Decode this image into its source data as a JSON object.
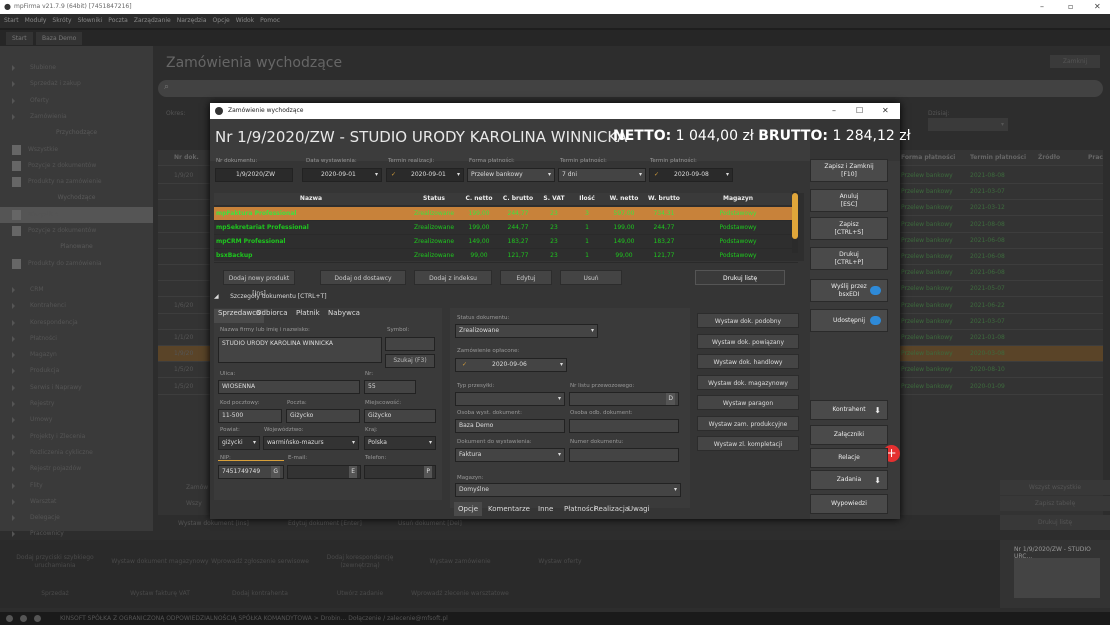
{
  "os_title": "mpFirma v21.7.9 (64bit) [7451847216]",
  "menu": [
    "Start",
    "Moduły",
    "Skróty",
    "Słowniki",
    "Poczta",
    "Zarządzanie",
    "Narzędzia",
    "Opcje",
    "Widok",
    "Pomoc"
  ],
  "app_tabs": [
    "Start",
    "Baza Demo"
  ],
  "sidebar": {
    "items": [
      {
        "label": "Słubione",
        "type": "item"
      },
      {
        "label": "Sprzedaż i zakup",
        "type": "item"
      },
      {
        "label": "Oferty",
        "type": "item"
      },
      {
        "label": "Zamówienia",
        "type": "item"
      },
      {
        "label": "Przychodzące",
        "type": "header"
      },
      {
        "label": "Wszystkie",
        "type": "sub"
      },
      {
        "label": "Pozycje z dokumentów",
        "type": "sub"
      },
      {
        "label": "Produkty na zamówienie",
        "type": "sub"
      },
      {
        "label": "Wychodzące",
        "type": "header"
      },
      {
        "label": "Wszystkie",
        "type": "sub"
      },
      {
        "label": "Pozycje z dokumentów",
        "type": "sub"
      },
      {
        "label": "Planowane",
        "type": "header"
      },
      {
        "label": "Produkty do zamówienia",
        "type": "sub"
      },
      {
        "label": "",
        "type": "gap"
      },
      {
        "label": "CRM",
        "type": "item"
      },
      {
        "label": "Kontrahenci",
        "type": "item"
      },
      {
        "label": "Korespondencja",
        "type": "item"
      },
      {
        "label": "Płatności",
        "type": "item"
      },
      {
        "label": "Magazyn",
        "type": "item"
      },
      {
        "label": "Produkcja",
        "type": "item"
      },
      {
        "label": "Serwis i Naprawy",
        "type": "item"
      },
      {
        "label": "Rejestry",
        "type": "item"
      },
      {
        "label": "Umowy",
        "type": "item"
      },
      {
        "label": "Projekty i Zlecenia",
        "type": "item"
      },
      {
        "label": "Rozliczenia cykliczne",
        "type": "item"
      },
      {
        "label": "Rejestr pojazdów",
        "type": "item"
      },
      {
        "label": "Flity",
        "type": "item"
      },
      {
        "label": "Warsztat",
        "type": "item"
      },
      {
        "label": "Delegacje",
        "type": "item"
      },
      {
        "label": "Pracownicy",
        "type": "item"
      }
    ]
  },
  "page": {
    "title": "Zamówienia wychodzące",
    "close": "Zamknij"
  },
  "bg_filters": {
    "left": "Okres:",
    "right": "Dzisiaj:"
  },
  "bg_table": {
    "headers": [
      "Nr dok.",
      "Forma płatności",
      "Termin płatności",
      "Źródło",
      "Prac"
    ],
    "rows": [
      {
        "nr": "",
        "forma": "Przelew bankowy",
        "termin": "2021-08-08"
      },
      {
        "nr": "",
        "forma": "Przelew bankowy",
        "termin": "2021-03-07"
      },
      {
        "nr": "",
        "forma": "Przelew bankowy",
        "termin": "2021-03-12"
      },
      {
        "nr": "",
        "forma": "Przelew bankowy",
        "termin": "2021-08-08"
      },
      {
        "nr": "",
        "forma": "Przelew bankowy",
        "termin": "2021-06-08"
      },
      {
        "nr": "",
        "forma": "Przelew bankowy",
        "termin": "2021-06-08"
      },
      {
        "nr": "",
        "forma": "Przelew bankowy",
        "termin": "2021-06-08"
      },
      {
        "nr": "",
        "forma": "Przelew bankowy",
        "termin": "2021-05-07"
      },
      {
        "nr": "",
        "forma": "Przelew bankowy",
        "termin": "2021-06-22"
      },
      {
        "nr": "",
        "forma": "Przelew bankowy",
        "termin": "2021-03-07"
      },
      {
        "nr": "",
        "forma": "Przelew bankowy",
        "termin": "2021-01-08"
      },
      {
        "nr": "",
        "forma": "Przelew bankowy",
        "termin": "2020-03-08"
      },
      {
        "nr": "",
        "forma": "Przelew bankowy",
        "termin": "2020-08-10"
      },
      {
        "nr": "",
        "forma": "Przelew bankowy",
        "termin": "2020-01-09"
      }
    ],
    "row_dates": [
      "1/9/20",
      "",
      "",
      "",
      "",
      "",
      "",
      "",
      "1/6/20",
      "",
      "1/1/20",
      "1/9/20",
      "1/5/20",
      "1/5/20"
    ],
    "bottom_buttons": [
      "Wystaw dokument [Ins]",
      "Edytuj dokument [Enter]",
      "Usuń dokument [Del]"
    ],
    "left_labels": [
      "Zamów",
      "Wszy"
    ]
  },
  "bg_right_buttons": [
    "Wszyst wszystkie",
    "Zapisz tabelę",
    "Drukuj listę"
  ],
  "bottom_tiles": [
    "Dodaj przyciski szybkiego uruchamiania",
    "Wystaw dokument magazynowy",
    "Wprowadź zgłoszenie serwisowe",
    "Dodaj korespondencję (zewnętrzną)",
    "Wystaw zamówienie",
    "Wystaw oferty",
    "Sprzedaż",
    "Wystaw fakturę VAT",
    "Dodaj kontrahenta",
    "Utwórz zadanie",
    "Wprowadź zlecenie warsztatowe"
  ],
  "thumb_title": "Nr 1/9/2020/ZW - STUDIO URC...",
  "status": "KINSOFT SPÓŁKA Z OGRANICZONĄ ODPOWIEDZIALNOŚCIĄ SPÓŁKA KOMANDYTOWA > Drobin... Dołączenie / zalecenie@mfsoft.pl",
  "dialog": {
    "title": "Zamówienie wychodzące",
    "doc_header": "Nr 1/9/2020/ZW - STUDIO URODY KAROLINA WINNICKA",
    "netto_label": "NETTO:",
    "netto_value": "1 044,00 zł",
    "brutto_label": "BRUTTO:",
    "brutto_value": "1 284,12 zł",
    "fields": {
      "nr_label": "Nr dokumentu:",
      "nr": "1/9/2020/ZW",
      "data_label": "Data wystawienia:",
      "data": "2020-09-01",
      "termin_real_label": "Termin realizacji:",
      "termin_real": "2020-09-01",
      "forma_label": "Forma płatności:",
      "forma": "Przelew bankowy",
      "termin_plat_label": "Termin płatności:",
      "termin_plat": "7 dni",
      "termin_plat2_label": "Termin płatności:",
      "termin_plat2": "2020-09-08"
    },
    "grid": {
      "headers": [
        "Nazwa",
        "Status",
        "C. netto",
        "C. brutto",
        "S. VAT",
        "Ilość",
        "W. netto",
        "W. brutto",
        "Magazyn"
      ],
      "rows": [
        [
          "mpFaktura Professional",
          "Zrealizowane",
          "199,00",
          "244,77",
          "23",
          "3",
          "597,00",
          "734,31",
          "Podstawowy"
        ],
        [
          "mpSekretariat Professional",
          "Zrealizowane",
          "199,00",
          "244,77",
          "23",
          "1",
          "199,00",
          "244,77",
          "Podstawowy"
        ],
        [
          "mpCRM Professional",
          "Zrealizowane",
          "149,00",
          "183,27",
          "23",
          "1",
          "149,00",
          "183,27",
          "Podstawowy"
        ],
        [
          "bsxBackup",
          "Zrealizowane",
          "99,00",
          "121,77",
          "23",
          "1",
          "99,00",
          "121,77",
          "Podstawowy"
        ]
      ]
    },
    "grid_buttons": [
      "Dodaj nowy produkt [Ins]",
      "Dodaj od dostawcy",
      "Dodaj z indeksu",
      "Edytuj",
      "Usuń",
      "Drukuj listę"
    ],
    "details_toggle": "Szczegóły dokumentu [CTRL+T]",
    "party_tabs": [
      "Sprzedawca",
      "Odbiorca",
      "Płatnik",
      "Nabywca"
    ],
    "party": {
      "name_label": "Nazwa firmy lub imię i nazwisko:",
      "name": "STUDIO URODY KAROLINA WINNICKA",
      "symbol_label": "Symbol:",
      "symbol": "",
      "search_btn": "Szukaj (F3)",
      "ulica_label": "Ulica:",
      "ulica": "WIOSENNA",
      "nr_label": "Nr:",
      "nr": "55",
      "kod_label": "Kod pocztowy:",
      "kod": "11-500",
      "poczta_label": "Poczta:",
      "poczta": "Giżycko",
      "miejsc_label": "Miejscowość:",
      "miejsc": "Giżycko",
      "powiat_label": "Powiat:",
      "powiat": "giżycki",
      "woj_label": "Województwo:",
      "woj": "warmińsko-mazurs",
      "kraj_label": "Kraj:",
      "kraj": "Polska",
      "nip_label": "NIP:",
      "nip": "7451749749",
      "nip_btn": "G",
      "email_label": "E-mail:",
      "email": "",
      "email_btn": "E",
      "tel_label": "Telefon:",
      "tel": "",
      "tel_btn": "P"
    },
    "options": {
      "status_label": "Status dokumentu:",
      "status": "Zrealizowane",
      "paid_label": "Zamówienie opłacone:",
      "paid_date": "2020-09-06",
      "przesylka_label": "Typ przesyłki:",
      "przesylka": "",
      "nr_listu_label": "Nr listu przewozowego:",
      "nr_listu": "",
      "nr_listu_btn": "D",
      "osoba_wyst_label": "Osoba wyst. dokument:",
      "osoba_wyst": "Baza Demo",
      "osoba_odb_label": "Osoba odb. dokument:",
      "osoba_odb": "",
      "dok_label": "Dokument do wystawienia:",
      "dok": "Faktura",
      "numer_label": "Numer dokumentu:",
      "numer": "",
      "magazyn_label": "Magazyn:",
      "magazyn": "Domyślne"
    },
    "action_buttons": [
      "Wystaw dok. podobny",
      "Wystaw dok. powiązany",
      "Wystaw dok. handlowy",
      "Wystaw dok. magazynowy",
      "Wystaw paragon",
      "Wystaw zam. produkcyjne",
      "Wystaw zl. kompletacji"
    ],
    "bottom_tabs": [
      "Opcje",
      "Komentarze",
      "Inne",
      "Płatności",
      "Realizacja",
      "Uwagi"
    ],
    "right_buttons": [
      {
        "label": "Zapisz i Zamknij",
        "sub": "[F10]"
      },
      {
        "label": "Anuluj",
        "sub": "[ESC]"
      },
      {
        "label": "Zapisz",
        "sub": "[CTRL+S]"
      },
      {
        "label": "Drukuj",
        "sub": "[CTRL+P]"
      },
      {
        "label": "Wyślij przez",
        "sub": "bsxEDI"
      },
      {
        "label": "Udostępnij",
        "sub": ""
      }
    ],
    "right_buttons2": [
      "Kontrahent",
      "Załączniki",
      "Relacje",
      "Zadania",
      "Wypowiedzi"
    ]
  }
}
